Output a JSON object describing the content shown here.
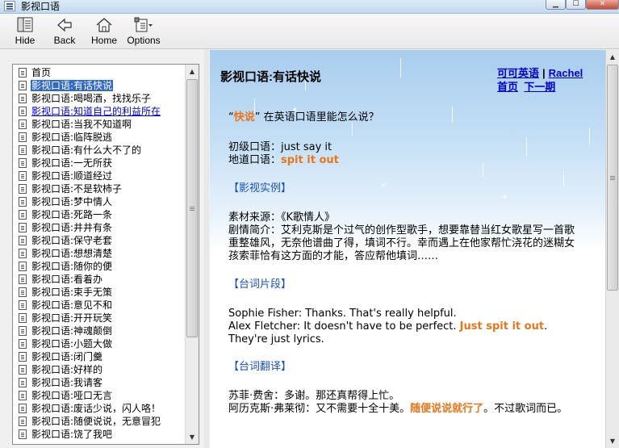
{
  "window": {
    "title": "影视口语"
  },
  "window_buttons": {
    "minimize": "▁",
    "maximize": "☐",
    "close": "✕"
  },
  "toolbar": {
    "hide": "Hide",
    "back": "Back",
    "home": "Home",
    "options": "Options"
  },
  "tree": {
    "items": [
      "首页",
      "影视口语:有话快说",
      "影视口语:喝喝酒，找找乐子",
      "影视口语:知道自己的利益所在",
      "影视口语:当我不知道啊",
      "影视口语:临阵脱逃",
      "影视口语:有什么大不了的",
      "影视口语:一无所获",
      "影视口语:顺道经过",
      "影视口语:不是软柿子",
      "影视口语:梦中情人",
      "影视口语:死路一条",
      "影视口语:井井有条",
      "影视口语:保守老套",
      "影视口语:想想清楚",
      "影视口语:随你的便",
      "影视口语:看着办",
      "影视口语:束手无策",
      "影视口语:意见不和",
      "影视口语:开开玩笑",
      "影视口语:神魂颠倒",
      "影视口语:小题大做",
      "影视口语:闭门羹",
      "影视口语:好样的",
      "影视口语:我请客",
      "影视口语:哑口无言",
      "影视口语:废话少说，闪人咯！",
      "影视口语:随便说说，无意冒犯",
      "影视口语:饶了我吧"
    ]
  },
  "content": {
    "title": "影视口语:有话快说",
    "links": {
      "site": "可可英语",
      "separator": "|",
      "author": "Rachel",
      "home": "首页",
      "next": "下一期"
    },
    "question": {
      "open": "“",
      "keyword": "快说",
      "rest": "” 在英语口语里能怎么说？"
    },
    "beginner": "初级口语：just say it",
    "advanced": {
      "label": "地道口语：",
      "phrase": "spit it out"
    },
    "section_example": "【影视实例】",
    "source": "素材来源：《K歌情人》",
    "synopsis": "剧情简介：艾利克斯是个过气的创作型歌手，想要靠替当红女歌星写一首歌重整雄风，无奈他谱曲了得，填词不行。幸而遇上在他家帮忙浇花的迷糊女孩索菲恰有这方面的才能，答应帮他填词……",
    "section_dialogue": "【台词片段】",
    "dialogue_1": "Sophie Fisher: Thanks. That's really helpful.",
    "dialogue_2": {
      "before": "Alex Fletcher: It doesn't have to be perfect. ",
      "highlight": "Just spit it out",
      "after": ". They're just lyrics."
    },
    "section_translation": "【台词翻译】",
    "translation_1": "苏菲·费舍：多谢。那还真帮得上忙。",
    "translation_2": {
      "before": "阿历克斯·弗莱彻：又不需要十全十美。",
      "highlight": "随便说说就行了",
      "after": "。不过歌词而已。"
    }
  },
  "colors": {
    "highlight": "#e8761a",
    "section": "#1a4fc0",
    "selection": "#3169c6",
    "link": "#0000cc"
  },
  "icons": [
    "app-icon",
    "hide-icon",
    "back-arrow-icon",
    "home-icon",
    "options-icon",
    "page-icon"
  ]
}
